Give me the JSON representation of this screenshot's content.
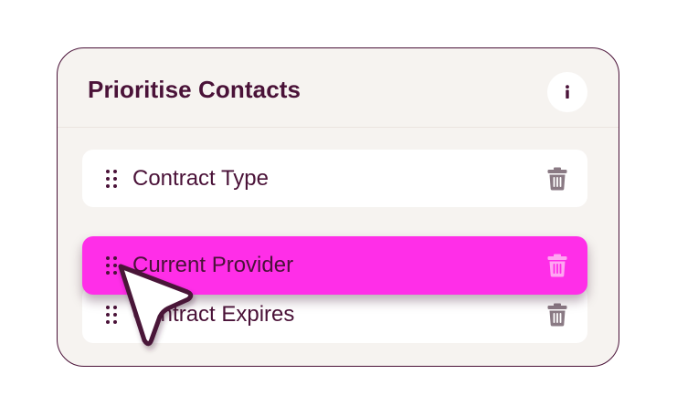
{
  "panel": {
    "title": "Prioritise Contacts",
    "info_icon": "info-icon",
    "info_label": "i"
  },
  "rows": [
    {
      "label": "Contract Type",
      "handle_icon": "drag-handle-icon",
      "delete_icon": "trash-icon"
    },
    {
      "label": "Current Provider",
      "handle_icon": "drag-handle-icon",
      "delete_icon": "trash-icon",
      "state": "dragging"
    },
    {
      "label": "Contract Expires",
      "handle_icon": "drag-handle-icon",
      "delete_icon": "trash-icon"
    }
  ],
  "colors": {
    "title": "#4a1238",
    "card_background": "#f6f3f0",
    "card_border": "#4a1238",
    "row_background": "#ffffff",
    "dragging_row_background": "#ff2ee8",
    "icon_muted": "#8a7a84",
    "cursor_fill": "#ffffff",
    "cursor_stroke": "#4a1238"
  },
  "cursor": {
    "icon": "pointer-cursor-icon"
  }
}
